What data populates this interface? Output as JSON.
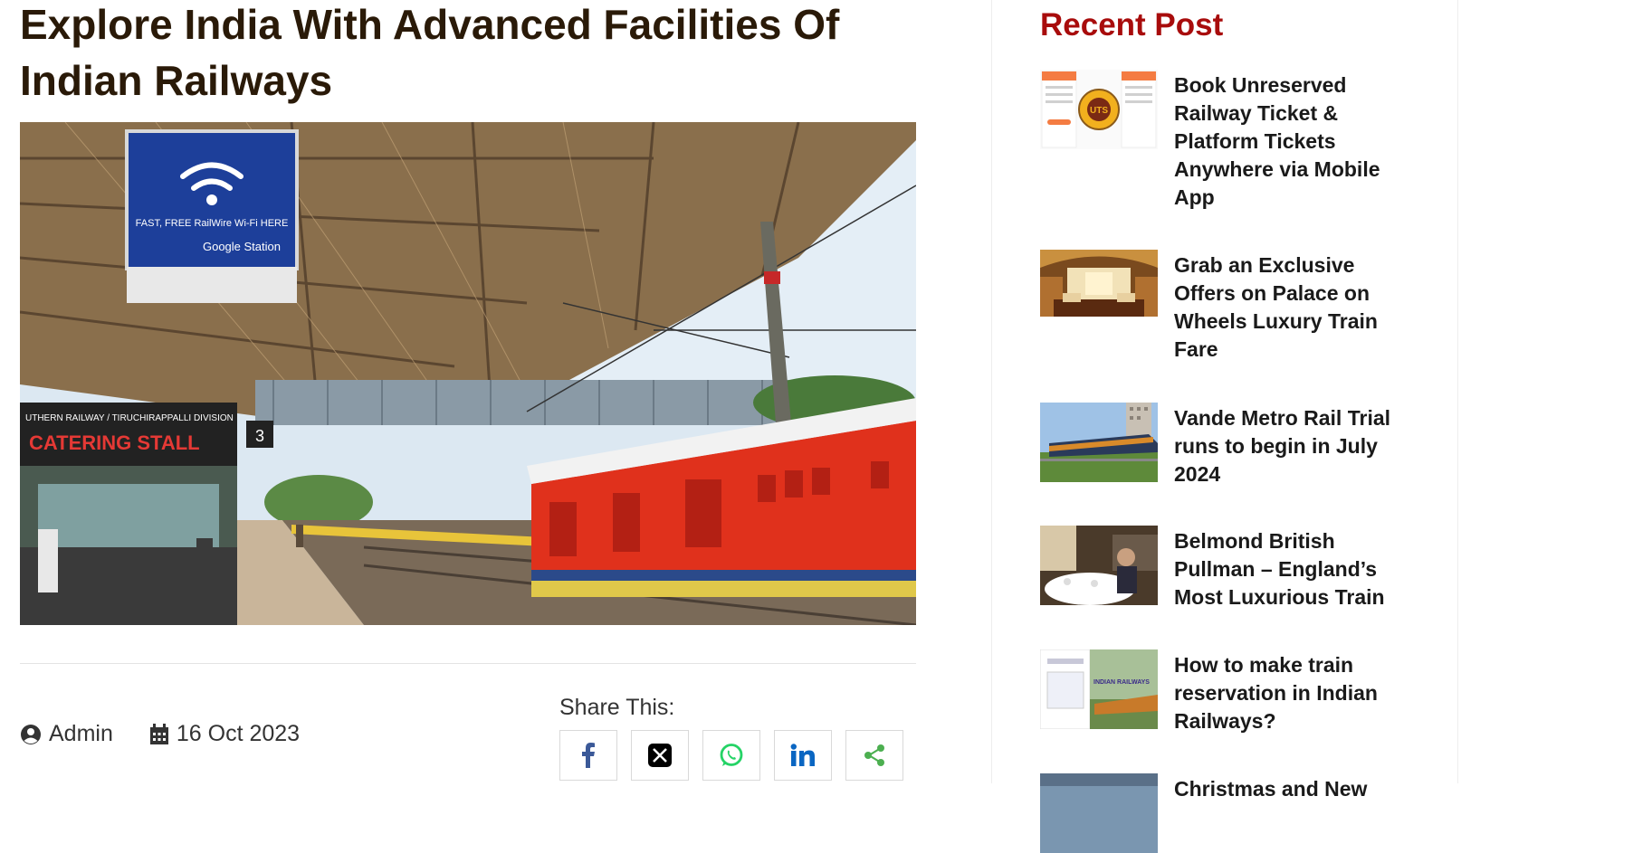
{
  "article": {
    "title": "Explore India With Advanced Facilities Of Indian Railways",
    "hero_sign_line1": "FAST, FREE RailWire Wi-Fi HERE",
    "hero_sign_brand": "Google Station",
    "hero_stall_top": "UTHERN RAILWAY / TIRUCHIRAPPALLI DIVISION",
    "hero_stall_name": "CATERING STALL",
    "hero_platform_no": "3",
    "author": "Admin",
    "date": "16 Oct 2023",
    "share_label": "Share This:"
  },
  "share_buttons": [
    {
      "icon": "facebook-icon",
      "color": "#3b5998"
    },
    {
      "icon": "x-icon",
      "color": "#000000"
    },
    {
      "icon": "whatsapp-icon",
      "color": "#25d366"
    },
    {
      "icon": "linkedin-icon",
      "color": "#0a66c2"
    },
    {
      "icon": "share-icon",
      "color": "#4caf50"
    }
  ],
  "sidebar": {
    "title": "Recent Post",
    "posts": [
      {
        "title": "Book Unreserved Railway Ticket & Platform Tickets Anywhere via Mobile App",
        "thumb_text": "UTS"
      },
      {
        "title": "Grab an Exclusive Offers on Palace on Wheels Luxury Train Fare"
      },
      {
        "title": "Vande Metro Rail Trial runs to begin in July 2024"
      },
      {
        "title": "Belmond British Pullman – England’s Most Luxurious Train"
      },
      {
        "title": "How to make train reservation in Indian Railways?",
        "thumb_text": "INDIAN RAILWAYS"
      },
      {
        "title": "Christmas and New"
      }
    ]
  },
  "colors": {
    "title": "#2a1a08",
    "sidebar_title": "#a80c0c",
    "train_red": "#e0311c"
  }
}
